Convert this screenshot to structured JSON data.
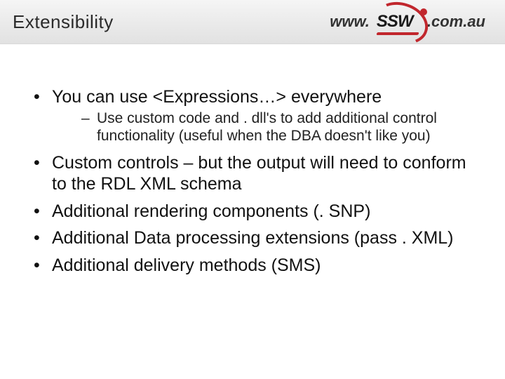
{
  "header": {
    "title": "Extensibility",
    "logo": {
      "prefix": "www.",
      "brand": "SSW",
      "suffix": ".com.au"
    }
  },
  "bullets": [
    {
      "text": "You can use <Expressions…> everywhere",
      "sub": [
        "Use custom code and . dll's to add additional control functionality (useful when the DBA doesn't like you)"
      ]
    },
    {
      "text": "Custom controls – but the output will need to conform to the RDL XML schema",
      "sub": []
    },
    {
      "text": "Additional rendering components (. SNP)",
      "sub": []
    },
    {
      "text": "Additional Data processing extensions (pass . XML)",
      "sub": []
    },
    {
      "text": "Additional delivery methods (SMS)",
      "sub": []
    }
  ]
}
